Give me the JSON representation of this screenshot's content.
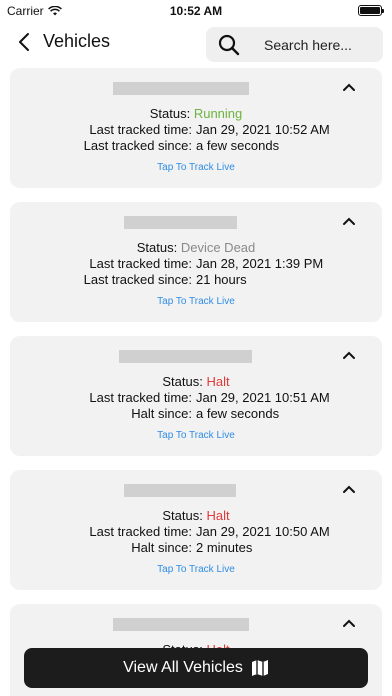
{
  "statusbar": {
    "carrier": "Carrier",
    "time": "10:52 AM"
  },
  "header": {
    "title": "Vehicles",
    "search_placeholder": "Search here..."
  },
  "labels": {
    "status": "Status:",
    "last_tracked_time": "Last tracked time:",
    "last_tracked_since": "Last tracked since:",
    "halt_since": "Halt since:",
    "track_live": "Tap To Track Live"
  },
  "colors": {
    "running": "#6db33f",
    "device_dead": "#8a8a8a",
    "halt": "#e03b3b",
    "link": "#2f8de4"
  },
  "vehicles": [
    {
      "status": "Running",
      "time": "Jan 29, 2021 10:52 AM",
      "since": "a few seconds"
    },
    {
      "status": "Device Dead",
      "time": "Jan 28, 2021 1:39 PM",
      "since": "21 hours"
    },
    {
      "status": "Halt",
      "time": "Jan 29, 2021 10:51 AM",
      "since": "a few seconds"
    },
    {
      "status": "Halt",
      "time": "Jan 29, 2021 10:50 AM",
      "since": "2 minutes"
    },
    {
      "status": "Halt"
    }
  ],
  "footer": {
    "view_all": "View All Vehicles"
  }
}
